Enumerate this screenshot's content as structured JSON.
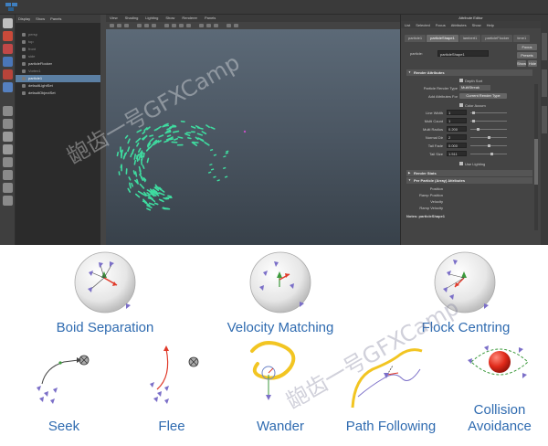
{
  "outliner": {
    "menu": [
      "Display",
      "Show",
      "Panels"
    ],
    "items": [
      {
        "label": "persp",
        "style": "dim"
      },
      {
        "label": "top",
        "style": "dim"
      },
      {
        "label": "front",
        "style": "dim"
      },
      {
        "label": "side",
        "style": "dim"
      },
      {
        "label": "particleFlocker",
        "style": "bright"
      },
      {
        "label": "Vortex1",
        "style": "dim"
      },
      {
        "label": "particle1",
        "style": "selected"
      },
      {
        "label": "defaultLightSet",
        "style": "bright"
      },
      {
        "label": "defaultObjectSet",
        "style": "bright"
      }
    ]
  },
  "viewport": {
    "menu": [
      "View",
      "Shading",
      "Lighting",
      "Show",
      "Renderer",
      "Panels"
    ]
  },
  "attribute_editor": {
    "title": "Attribute Editor",
    "menu": [
      "List",
      "Selected",
      "Focus",
      "Attributes",
      "Show",
      "Help"
    ],
    "tabs": [
      "particle1",
      "particleShape1",
      "lambert1",
      "particleFlocker",
      "time1"
    ],
    "focus_button": "Focus",
    "presets_button": "Presets",
    "show_button": "Show",
    "hide_button": "Hide",
    "particle_label": "particle:",
    "particle_value": "particleShape1",
    "render_attributes": {
      "header": "Render Attributes",
      "depth_sort": "Depth Sort",
      "render_type_label": "Particle Render Type",
      "render_type_value": "MultiStreak",
      "add_attrs_label": "Add Attributes For",
      "add_attrs_button": "Current Render Type",
      "color_accum": "Color Accum",
      "rows": [
        {
          "label": "Line Width",
          "value": "1",
          "knob": 0.05
        },
        {
          "label": "Multi Count",
          "value": "1",
          "knob": 0.05
        },
        {
          "label": "Multi Radius",
          "value": "0.200",
          "knob": 0.2
        },
        {
          "label": "Normal Dir",
          "value": "2",
          "knob": 0.5
        },
        {
          "label": "Tail Fade",
          "value": "0.000",
          "knob": 0.5
        },
        {
          "label": "Tail Size",
          "value": "1.511",
          "knob": 0.6
        }
      ],
      "use_lighting": "Use Lighting"
    },
    "render_stats": "Render Stats",
    "per_particle": {
      "header": "Per Particle (Array) Attributes",
      "rows": [
        "Position",
        "Ramp Position",
        "Velocity",
        "Ramp Velocity"
      ]
    },
    "notes": "Notes:  particleShape1"
  },
  "behaviours": {
    "boid_separation": "Boid Separation",
    "velocity_matching": "Velocity Matching",
    "flock_centring": "Flock Centring",
    "seek": "Seek",
    "flee": "Flee",
    "wander": "Wander",
    "path_following": "Path Following",
    "collision_avoidance_1": "Collision",
    "collision_avoidance_2": "Avoidance"
  },
  "watermark": "龅齿一号GFXCamp",
  "colors": {
    "caption": "#2f6bb0",
    "particle": "#3fdca0",
    "agent": "#7b6fc8",
    "arrow_red": "#e03a2a",
    "arrow_green": "#3c9a3c",
    "path_yellow": "#f2c522"
  }
}
